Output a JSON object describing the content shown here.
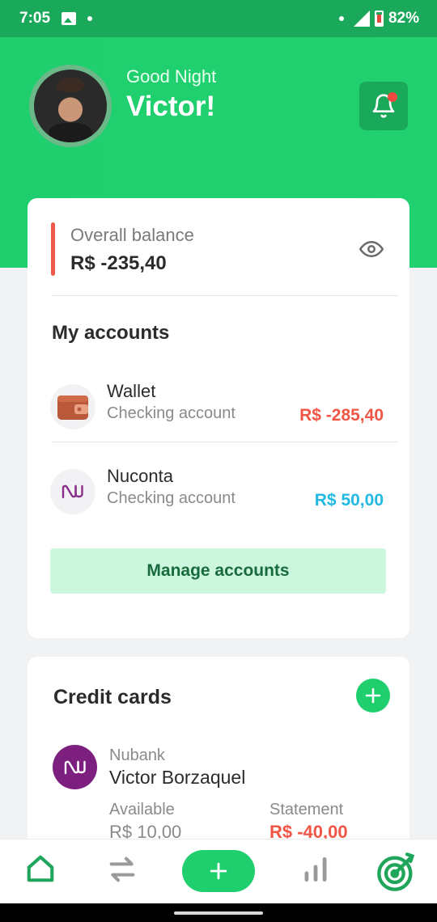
{
  "status_bar": {
    "time": "7:05",
    "battery": "82%"
  },
  "header": {
    "greeting": "Good Night",
    "name": "Victor!"
  },
  "balance": {
    "label": "Overall balance",
    "value": "R$ -235,40"
  },
  "accounts": {
    "title": "My accounts",
    "items": [
      {
        "name": "Wallet",
        "type": "Checking account",
        "value": "R$ -285,40",
        "value_color": "#ef5646",
        "icon": "wallet-icon"
      },
      {
        "name": "Nuconta",
        "type": "Checking account",
        "value": "R$ 50,00",
        "value_color": "#22b9e3",
        "icon": "nubank-icon"
      }
    ],
    "manage_label": "Manage accounts"
  },
  "credit_cards": {
    "title": "Credit cards",
    "card": {
      "bank": "Nubank",
      "holder": "Victor Borzaquel",
      "available_label": "Available",
      "available_value": "R$ 10,00",
      "statement_label": "Statement",
      "statement_value": "R$ -40,00"
    }
  },
  "nav": [
    "home-icon",
    "transactions-icon",
    "add-icon",
    "reports-icon",
    "goals-icon"
  ],
  "colors": {
    "primary": "#1fcf6d",
    "negative": "#ef5646",
    "positive": "#22b9e3"
  }
}
